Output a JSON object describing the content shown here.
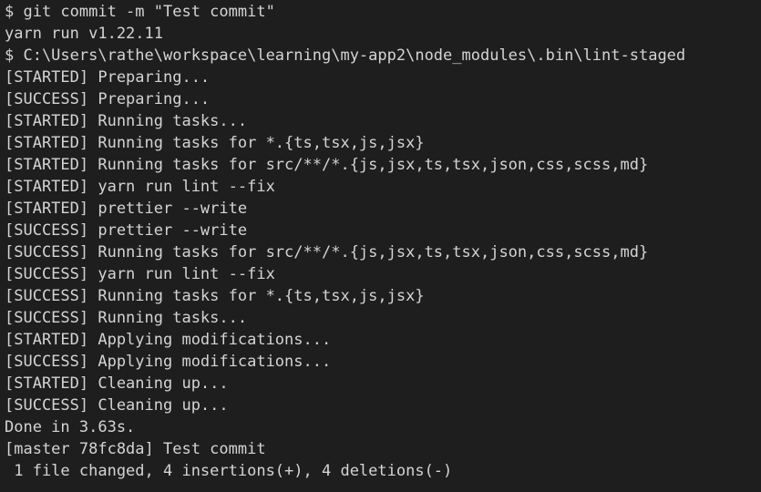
{
  "terminal": {
    "lines": [
      "$ git commit -m \"Test commit\"",
      "yarn run v1.22.11",
      "$ C:\\Users\\rathe\\workspace\\learning\\my-app2\\node_modules\\.bin\\lint-staged",
      "[STARTED] Preparing...",
      "[SUCCESS] Preparing...",
      "[STARTED] Running tasks...",
      "[STARTED] Running tasks for *.{ts,tsx,js,jsx}",
      "[STARTED] Running tasks for src/**/*.{js,jsx,ts,tsx,json,css,scss,md}",
      "[STARTED] yarn run lint --fix",
      "[STARTED] prettier --write",
      "[SUCCESS] prettier --write",
      "[SUCCESS] Running tasks for src/**/*.{js,jsx,ts,tsx,json,css,scss,md}",
      "[SUCCESS] yarn run lint --fix",
      "[SUCCESS] Running tasks for *.{ts,tsx,js,jsx}",
      "[SUCCESS] Running tasks...",
      "[STARTED] Applying modifications...",
      "[SUCCESS] Applying modifications...",
      "[STARTED] Cleaning up...",
      "[SUCCESS] Cleaning up...",
      "Done in 3.63s.",
      "[master 78fc8da] Test commit",
      " 1 file changed, 4 insertions(+), 4 deletions(-)"
    ]
  }
}
